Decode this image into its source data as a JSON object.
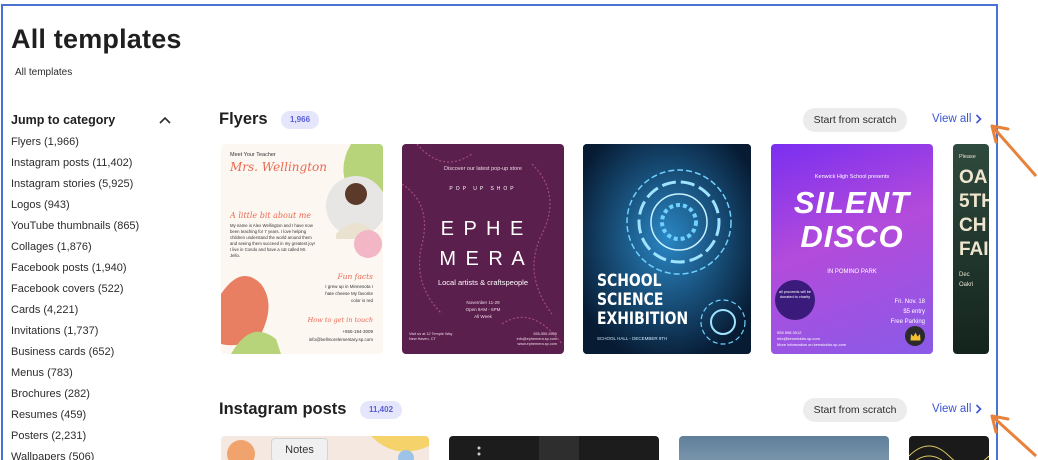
{
  "page": {
    "title": "All templates",
    "breadcrumb": "All templates"
  },
  "sidebar": {
    "heading": "Jump to category",
    "categories": [
      "Flyers (1,966)",
      "Instagram posts (11,402)",
      "Instagram stories (5,925)",
      "Logos (943)",
      "YouTube thumbnails (865)",
      "Collages (1,876)",
      "Facebook posts (1,940)",
      "Facebook covers (522)",
      "Cards (4,221)",
      "Invitations (1,737)",
      "Business cards (652)",
      "Menus (783)",
      "Brochures (282)",
      "Resumes (459)",
      "Posters (2,231)",
      "Wallpapers (506)"
    ]
  },
  "flyers": {
    "title": "Flyers",
    "count": "1,966",
    "scratch": "Start from scratch",
    "view_all": "View all",
    "cards": {
      "teacher": {
        "tag": "Meet Your Teacher",
        "name": "Mrs. Wellington",
        "about": "A little bit about me",
        "bio": "My name is Alex Wellington and I have now been teaching for 7 years. I love helping children understand the world around them and seeing them succeed in my greatest joy! I live in Condo and have a cat called Mr. Jello.",
        "fun_title": "Fun facts",
        "fun_facts": "I grew up in Minnesota I hate cheese My favorite color is red",
        "contact_title": "How to get in touch",
        "phone": "+555-194-3009",
        "email": "info@bellmorelementary.sp.com"
      },
      "ephemera": {
        "tag": "Discover our latest pop-up store",
        "arc": "POP UP SHOP",
        "line1": "E P H E",
        "line2": "M E R A",
        "sub": "Local artists & craftspeople",
        "date": "November 11-29",
        "hours": "Open 9AM - 6PM",
        "days": "All Week",
        "addr_left": "Visit us at 12 Temple Way New Haven, CT",
        "addr_right": "555-555-5555 info@ephemera.sp.com www.ephemera.sp.com"
      },
      "science": {
        "line1": "SCHOOL",
        "line2": "SCIENCE",
        "line3": "EXHIBITION",
        "footer": "SCHOOL HALL - DECEMBER 9TH"
      },
      "disco": {
        "tag": "Kenwick High School presents",
        "line1": "SILENT",
        "line2": "DISCO",
        "place": "IN POMINO PARK",
        "badge": "all proceeds will be donated to charity",
        "date": "Fri. Nov. 18",
        "entry": "$5 entry",
        "parking": "Free Parking",
        "phone": "555 598 0012",
        "site": "info@kenwickhs.sp.com",
        "info": "More information on kenwickhs.sp.com"
      },
      "partial": {
        "tag": "Please",
        "big": "OA 5TH CH FAI",
        "date": "Dec",
        "sub": "Oakri"
      }
    }
  },
  "instagram": {
    "title": "Instagram posts",
    "count": "11,402",
    "scratch": "Start from scratch",
    "view_all": "View all"
  },
  "notes_tab": "Notes"
}
